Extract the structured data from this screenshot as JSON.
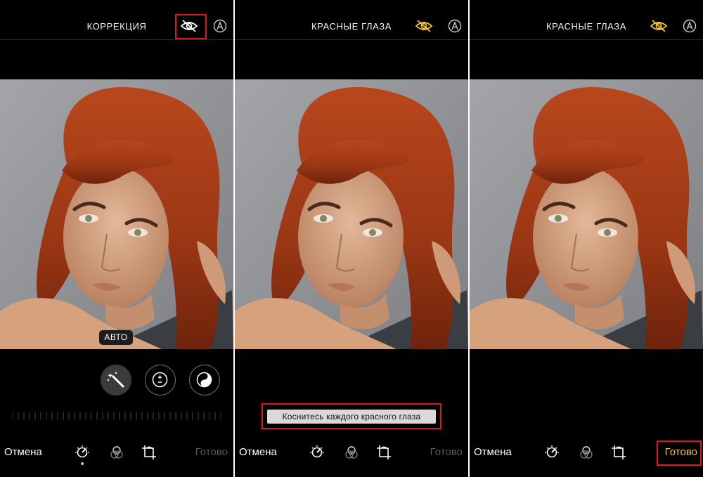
{
  "panels": [
    {
      "title": "КОРРЕКЦИЯ",
      "auto_label": "АВТО",
      "cancel_label": "Отмена",
      "done_label": "Готово",
      "eye_color": "#ffffff",
      "done_active": false,
      "icons": [
        "red-eye-tool-icon",
        "auto-enhance-icon",
        "magic-wand-icon",
        "exposure-icon",
        "color-filter-icon",
        "adjust-dial-icon",
        "filters-icon",
        "crop-rotate-icon"
      ]
    },
    {
      "title": "КРАСНЫЕ ГЛАЗА",
      "hint": "Коснитесь каждого красного глаза",
      "cancel_label": "Отмена",
      "done_label": "Готово",
      "eye_color": "#f4c431",
      "done_active": false
    },
    {
      "title": "КРАСНЫЕ ГЛАЗА",
      "cancel_label": "Отмена",
      "done_label": "Готово",
      "eye_color": "#f4c431",
      "done_active": true
    }
  ],
  "colors": {
    "accent": "#f4c431",
    "highlight_box": "#e0161b",
    "background": "#000000"
  }
}
